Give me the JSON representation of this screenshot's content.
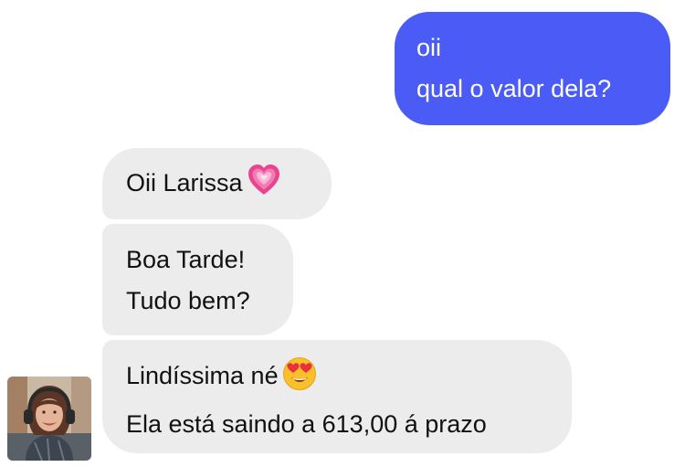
{
  "chat": {
    "sent": {
      "lines": [
        "oii",
        "qual o valor dela?"
      ],
      "color": "#4a5cf5"
    },
    "received": [
      {
        "lines": [
          "Oii Larissa"
        ],
        "emoji": "growing-heart-emoji"
      },
      {
        "lines": [
          "Boa Tarde!",
          "Tudo bem?"
        ]
      },
      {
        "lines": [
          "Lindíssima né",
          "Ela está saindo a 613,00 á prazo"
        ],
        "emoji": "heart-eyes-emoji"
      }
    ],
    "received_color": "#ececec"
  }
}
